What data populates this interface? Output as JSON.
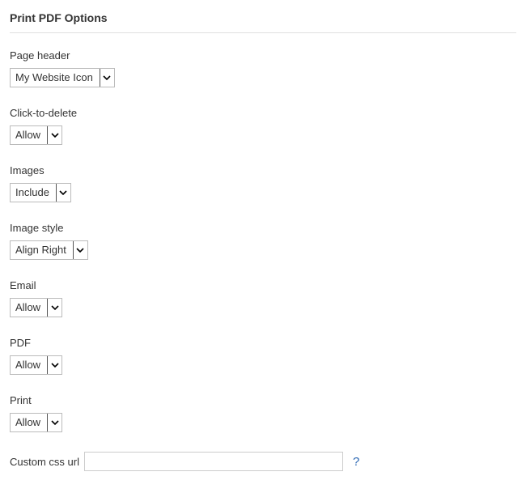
{
  "title": "Print PDF Options",
  "fields": {
    "page_header": {
      "label": "Page header",
      "value": "My Website Icon"
    },
    "click_to_delete": {
      "label": "Click-to-delete",
      "value": "Allow"
    },
    "images": {
      "label": "Images",
      "value": "Include"
    },
    "image_style": {
      "label": "Image style",
      "value": "Align Right"
    },
    "email": {
      "label": "Email",
      "value": "Allow"
    },
    "pdf": {
      "label": "PDF",
      "value": "Allow"
    },
    "print": {
      "label": "Print",
      "value": "Allow"
    },
    "custom_css_url": {
      "label": "Custom css url",
      "value": ""
    }
  },
  "help_link_label": "?"
}
